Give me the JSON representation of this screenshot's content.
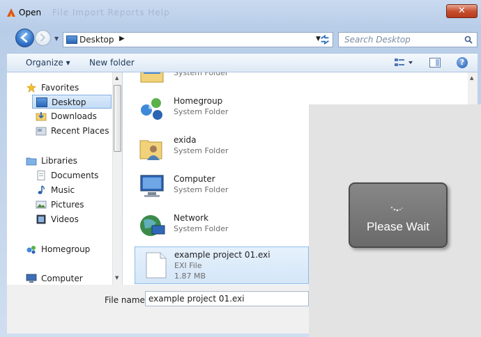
{
  "window": {
    "title": "Open",
    "title_ghost": "File  Import  Reports  Help",
    "close_label": "✕"
  },
  "nav": {
    "address_location": "Desktop",
    "search_placeholder": "Search Desktop"
  },
  "toolbar": {
    "organize_label": "Organize ▾",
    "new_folder_label": "New folder"
  },
  "sidebar": {
    "groups": [
      {
        "label": "Favorites",
        "icon": "star-icon"
      },
      {
        "label": "Libraries",
        "icon": "library-icon"
      },
      {
        "label": "Homegroup",
        "icon": "homegroup-icon"
      },
      {
        "label": "Computer",
        "icon": "computer-icon"
      }
    ],
    "favorites": [
      {
        "label": "Desktop",
        "icon": "desktop-icon",
        "selected": true
      },
      {
        "label": "Downloads",
        "icon": "downloads-icon"
      },
      {
        "label": "Recent Places",
        "icon": "recent-places-icon"
      }
    ],
    "libraries": [
      {
        "label": "Documents",
        "icon": "documents-icon"
      },
      {
        "label": "Music",
        "icon": "music-icon"
      },
      {
        "label": "Pictures",
        "icon": "pictures-icon"
      },
      {
        "label": "Videos",
        "icon": "videos-icon"
      }
    ]
  },
  "items": [
    {
      "name": "",
      "type": "System Folder",
      "icon": "folder-icon"
    },
    {
      "name": "Homegroup",
      "type": "System Folder",
      "icon": "homegroup-icon"
    },
    {
      "name": "exida",
      "type": "System Folder",
      "icon": "user-folder-icon"
    },
    {
      "name": "Computer",
      "type": "System Folder",
      "icon": "computer-icon"
    },
    {
      "name": "Network",
      "type": "System Folder",
      "icon": "network-icon"
    },
    {
      "name": "example project 01.exi",
      "type": "EXI File",
      "size": "1.87 MB",
      "icon": "file-icon",
      "selected": true
    }
  ],
  "file_name": {
    "label": "File name:",
    "value": "example project 01.exi"
  },
  "overlay": {
    "message": "Please Wait"
  }
}
